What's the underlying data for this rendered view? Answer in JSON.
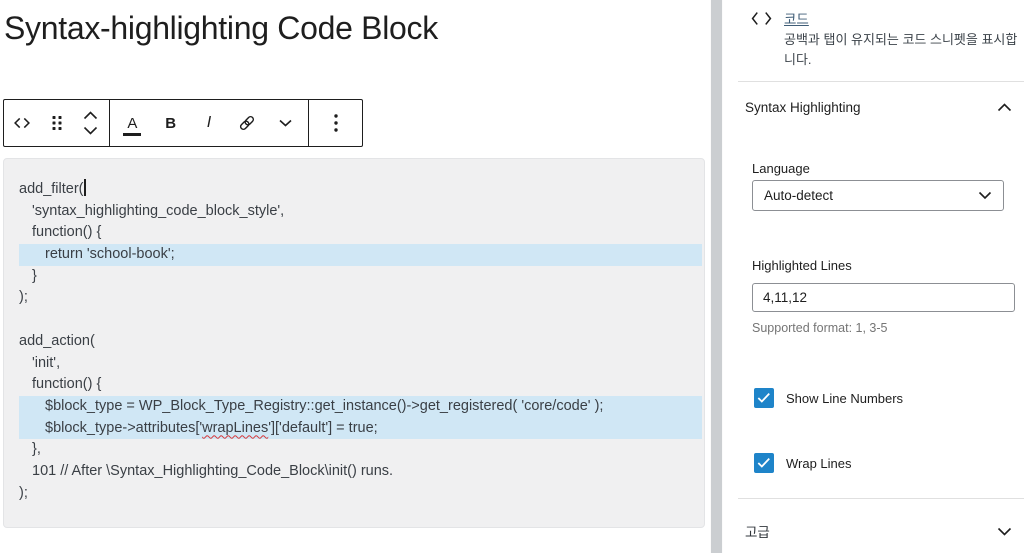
{
  "colors": {
    "text": "#1e1e1e",
    "code_text": "#3a3f45",
    "code_bg": "#f0f0f1",
    "line_highlight": "#d0e7f5",
    "toolbar_border": "#1e1e1e",
    "divider": "#e0e0e0",
    "muted": "#757575",
    "link": "#3f5d77",
    "accent": "#1e84c9",
    "scrollbar": "#cbced1"
  },
  "editor": {
    "title": "Syntax-highlighting Code Block",
    "toolbar": {
      "highlight_label": "A",
      "bold_label": "B",
      "italic_label": "I"
    },
    "code": {
      "lines": [
        {
          "text": "add_filter(",
          "indent": 0,
          "caret": true
        },
        {
          "text": "'syntax_highlighting_code_block_style',",
          "indent": 1
        },
        {
          "text": "function() {",
          "indent": 1
        },
        {
          "text": "return 'school-book';",
          "indent": 2,
          "highlight": true
        },
        {
          "text": "}",
          "indent": 1
        },
        {
          "text": ");",
          "indent": 0
        },
        {
          "text": "",
          "indent": 0
        },
        {
          "text": "add_action(",
          "indent": 0
        },
        {
          "text": "'init',",
          "indent": 1
        },
        {
          "text": "function() {",
          "indent": 1
        },
        {
          "text": "$block_type = WP_Block_Type_Registry::get_instance()->get_registered( 'core/code' );",
          "indent": 2,
          "highlight": true
        },
        {
          "parts": [
            {
              "t": "$block_type->attributes['"
            },
            {
              "t": "wrapLines",
              "spell_error": true
            },
            {
              "t": "']['default'] = true;"
            }
          ],
          "indent": 2,
          "highlight": true
        },
        {
          "text": "},",
          "indent": 1
        },
        {
          "text": "101 // After \\Syntax_Highlighting_Code_Block\\init() runs.",
          "indent": 1
        },
        {
          "text": ");",
          "indent": 0
        }
      ]
    }
  },
  "sidebar": {
    "block_card": {
      "title": "코드",
      "description": "공백과 탭이 유지되는 코드 스니펫을 표시합니다."
    },
    "syntax_panel": {
      "title": "Syntax Highlighting"
    },
    "language": {
      "label": "Language",
      "value": "Auto-detect"
    },
    "highlighted_lines": {
      "label": "Highlighted Lines",
      "value": "4,11,12",
      "help": "Supported format: 1, 3-5"
    },
    "checkboxes": [
      {
        "label": "Show Line Numbers",
        "checked": true
      },
      {
        "label": "Wrap Lines",
        "checked": true
      }
    ],
    "advanced": {
      "title": "고급"
    }
  }
}
